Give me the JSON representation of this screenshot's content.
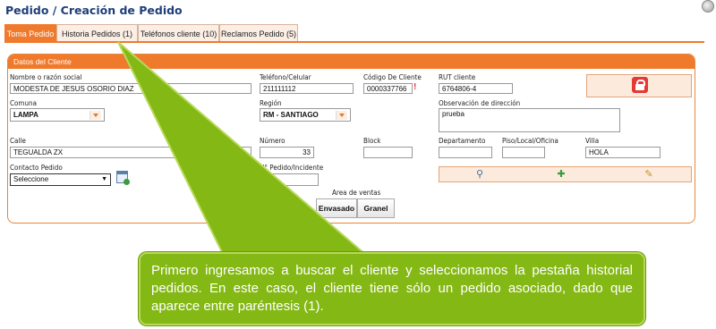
{
  "page": {
    "title": "Pedido / Creación de Pedido"
  },
  "tabs": [
    {
      "label": "Toma Pedido"
    },
    {
      "label": "Historia Pedidos (1)"
    },
    {
      "label": "Teléfonos cliente (10)"
    },
    {
      "label": "Reclamos Pedido (5)"
    }
  ],
  "panel": {
    "title": "Datos del Cliente"
  },
  "fields": {
    "nombre": {
      "label": "Nombre o razón social",
      "value": "MODESTA DE JESUS OSORIO DIAZ"
    },
    "telefono": {
      "label": "Teléfono/Celular",
      "value": "211111112"
    },
    "codigo": {
      "label": "Código De Cliente",
      "value": "0000337766"
    },
    "rut": {
      "label": "RUT cliente",
      "value": "6764806-4"
    },
    "comuna": {
      "label": "Comuna",
      "value": "LAMPA"
    },
    "region": {
      "label": "Región",
      "value": "RM - SANTIAGO"
    },
    "observacion": {
      "label": "Observación de dirección",
      "value": "prueba"
    },
    "calle": {
      "label": "Calle",
      "value": "TEGUALDA ZX"
    },
    "numero": {
      "label": "Número",
      "value": "33"
    },
    "block": {
      "label": "Block",
      "value": ""
    },
    "departamento": {
      "label": "Departamento",
      "value": ""
    },
    "piso": {
      "label": "Piso/Local/Oficina",
      "value": ""
    },
    "villa": {
      "label": "Villa",
      "value": "HOLA"
    },
    "contacto": {
      "label": "Contacto Pedido",
      "value": "Seleccione"
    },
    "pedido": {
      "label": "N° Pedido/Incidente",
      "value": ""
    }
  },
  "area_ventas": {
    "label": "Area de ventas",
    "options": [
      "Envasado",
      "Granel"
    ]
  },
  "icons": {
    "lock": "lock-icon",
    "search": "search-user-icon",
    "add": "add-user-icon",
    "edit": "edit-user-icon",
    "calendar": "calendar-add-icon"
  },
  "colors": {
    "accent": "#f07a2c",
    "callout": "#84b814"
  },
  "callout": {
    "text": "Primero ingresamos a buscar el cliente y seleccionamos la pestaña historial pedidos. En este caso, el cliente tiene sólo un pedido asociado, dado que aparece entre paréntesis (1)."
  }
}
